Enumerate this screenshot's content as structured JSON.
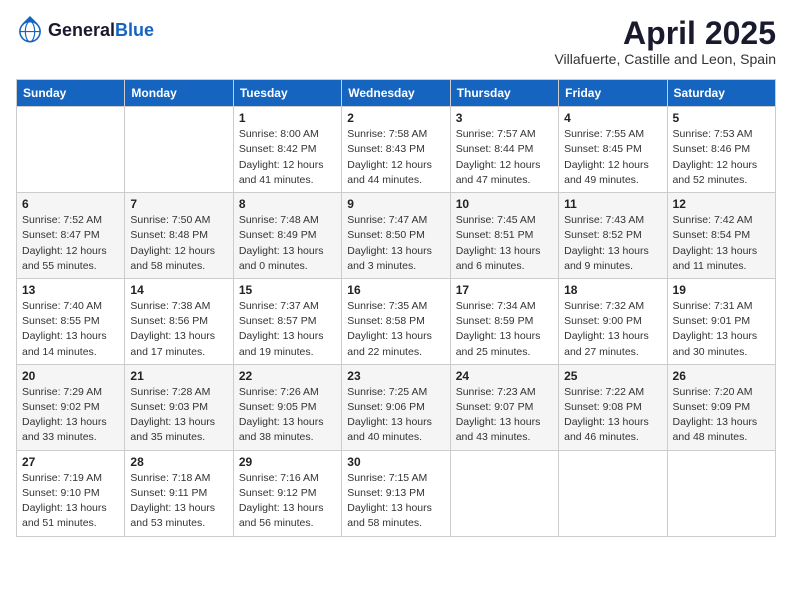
{
  "logo": {
    "general": "General",
    "blue": "Blue"
  },
  "title": "April 2025",
  "subtitle": "Villafuerte, Castille and Leon, Spain",
  "days_of_week": [
    "Sunday",
    "Monday",
    "Tuesday",
    "Wednesday",
    "Thursday",
    "Friday",
    "Saturday"
  ],
  "weeks": [
    [
      {
        "day": "",
        "info": ""
      },
      {
        "day": "",
        "info": ""
      },
      {
        "day": "1",
        "sunrise": "8:00 AM",
        "sunset": "8:42 PM",
        "daylight": "12 hours and 41 minutes."
      },
      {
        "day": "2",
        "sunrise": "7:58 AM",
        "sunset": "8:43 PM",
        "daylight": "12 hours and 44 minutes."
      },
      {
        "day": "3",
        "sunrise": "7:57 AM",
        "sunset": "8:44 PM",
        "daylight": "12 hours and 47 minutes."
      },
      {
        "day": "4",
        "sunrise": "7:55 AM",
        "sunset": "8:45 PM",
        "daylight": "12 hours and 49 minutes."
      },
      {
        "day": "5",
        "sunrise": "7:53 AM",
        "sunset": "8:46 PM",
        "daylight": "12 hours and 52 minutes."
      }
    ],
    [
      {
        "day": "6",
        "sunrise": "7:52 AM",
        "sunset": "8:47 PM",
        "daylight": "12 hours and 55 minutes."
      },
      {
        "day": "7",
        "sunrise": "7:50 AM",
        "sunset": "8:48 PM",
        "daylight": "12 hours and 58 minutes."
      },
      {
        "day": "8",
        "sunrise": "7:48 AM",
        "sunset": "8:49 PM",
        "daylight": "13 hours and 0 minutes."
      },
      {
        "day": "9",
        "sunrise": "7:47 AM",
        "sunset": "8:50 PM",
        "daylight": "13 hours and 3 minutes."
      },
      {
        "day": "10",
        "sunrise": "7:45 AM",
        "sunset": "8:51 PM",
        "daylight": "13 hours and 6 minutes."
      },
      {
        "day": "11",
        "sunrise": "7:43 AM",
        "sunset": "8:52 PM",
        "daylight": "13 hours and 9 minutes."
      },
      {
        "day": "12",
        "sunrise": "7:42 AM",
        "sunset": "8:54 PM",
        "daylight": "13 hours and 11 minutes."
      }
    ],
    [
      {
        "day": "13",
        "sunrise": "7:40 AM",
        "sunset": "8:55 PM",
        "daylight": "13 hours and 14 minutes."
      },
      {
        "day": "14",
        "sunrise": "7:38 AM",
        "sunset": "8:56 PM",
        "daylight": "13 hours and 17 minutes."
      },
      {
        "day": "15",
        "sunrise": "7:37 AM",
        "sunset": "8:57 PM",
        "daylight": "13 hours and 19 minutes."
      },
      {
        "day": "16",
        "sunrise": "7:35 AM",
        "sunset": "8:58 PM",
        "daylight": "13 hours and 22 minutes."
      },
      {
        "day": "17",
        "sunrise": "7:34 AM",
        "sunset": "8:59 PM",
        "daylight": "13 hours and 25 minutes."
      },
      {
        "day": "18",
        "sunrise": "7:32 AM",
        "sunset": "9:00 PM",
        "daylight": "13 hours and 27 minutes."
      },
      {
        "day": "19",
        "sunrise": "7:31 AM",
        "sunset": "9:01 PM",
        "daylight": "13 hours and 30 minutes."
      }
    ],
    [
      {
        "day": "20",
        "sunrise": "7:29 AM",
        "sunset": "9:02 PM",
        "daylight": "13 hours and 33 minutes."
      },
      {
        "day": "21",
        "sunrise": "7:28 AM",
        "sunset": "9:03 PM",
        "daylight": "13 hours and 35 minutes."
      },
      {
        "day": "22",
        "sunrise": "7:26 AM",
        "sunset": "9:05 PM",
        "daylight": "13 hours and 38 minutes."
      },
      {
        "day": "23",
        "sunrise": "7:25 AM",
        "sunset": "9:06 PM",
        "daylight": "13 hours and 40 minutes."
      },
      {
        "day": "24",
        "sunrise": "7:23 AM",
        "sunset": "9:07 PM",
        "daylight": "13 hours and 43 minutes."
      },
      {
        "day": "25",
        "sunrise": "7:22 AM",
        "sunset": "9:08 PM",
        "daylight": "13 hours and 46 minutes."
      },
      {
        "day": "26",
        "sunrise": "7:20 AM",
        "sunset": "9:09 PM",
        "daylight": "13 hours and 48 minutes."
      }
    ],
    [
      {
        "day": "27",
        "sunrise": "7:19 AM",
        "sunset": "9:10 PM",
        "daylight": "13 hours and 51 minutes."
      },
      {
        "day": "28",
        "sunrise": "7:18 AM",
        "sunset": "9:11 PM",
        "daylight": "13 hours and 53 minutes."
      },
      {
        "day": "29",
        "sunrise": "7:16 AM",
        "sunset": "9:12 PM",
        "daylight": "13 hours and 56 minutes."
      },
      {
        "day": "30",
        "sunrise": "7:15 AM",
        "sunset": "9:13 PM",
        "daylight": "13 hours and 58 minutes."
      },
      {
        "day": "",
        "info": ""
      },
      {
        "day": "",
        "info": ""
      },
      {
        "day": "",
        "info": ""
      }
    ]
  ],
  "labels": {
    "sunrise": "Sunrise:",
    "sunset": "Sunset:",
    "daylight": "Daylight:"
  }
}
